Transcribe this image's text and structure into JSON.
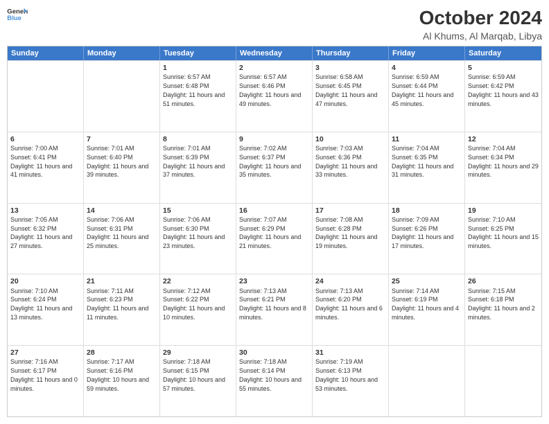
{
  "header": {
    "logo_line1": "General",
    "logo_line2": "Blue",
    "title": "October 2024",
    "subtitle": "Al Khums, Al Marqab, Libya"
  },
  "days_of_week": [
    "Sunday",
    "Monday",
    "Tuesday",
    "Wednesday",
    "Thursday",
    "Friday",
    "Saturday"
  ],
  "weeks": [
    [
      {
        "day": "",
        "sunrise": "",
        "sunset": "",
        "daylight": ""
      },
      {
        "day": "",
        "sunrise": "",
        "sunset": "",
        "daylight": ""
      },
      {
        "day": "1",
        "sunrise": "Sunrise: 6:57 AM",
        "sunset": "Sunset: 6:48 PM",
        "daylight": "Daylight: 11 hours and 51 minutes."
      },
      {
        "day": "2",
        "sunrise": "Sunrise: 6:57 AM",
        "sunset": "Sunset: 6:46 PM",
        "daylight": "Daylight: 11 hours and 49 minutes."
      },
      {
        "day": "3",
        "sunrise": "Sunrise: 6:58 AM",
        "sunset": "Sunset: 6:45 PM",
        "daylight": "Daylight: 11 hours and 47 minutes."
      },
      {
        "day": "4",
        "sunrise": "Sunrise: 6:59 AM",
        "sunset": "Sunset: 6:44 PM",
        "daylight": "Daylight: 11 hours and 45 minutes."
      },
      {
        "day": "5",
        "sunrise": "Sunrise: 6:59 AM",
        "sunset": "Sunset: 6:42 PM",
        "daylight": "Daylight: 11 hours and 43 minutes."
      }
    ],
    [
      {
        "day": "6",
        "sunrise": "Sunrise: 7:00 AM",
        "sunset": "Sunset: 6:41 PM",
        "daylight": "Daylight: 11 hours and 41 minutes."
      },
      {
        "day": "7",
        "sunrise": "Sunrise: 7:01 AM",
        "sunset": "Sunset: 6:40 PM",
        "daylight": "Daylight: 11 hours and 39 minutes."
      },
      {
        "day": "8",
        "sunrise": "Sunrise: 7:01 AM",
        "sunset": "Sunset: 6:39 PM",
        "daylight": "Daylight: 11 hours and 37 minutes."
      },
      {
        "day": "9",
        "sunrise": "Sunrise: 7:02 AM",
        "sunset": "Sunset: 6:37 PM",
        "daylight": "Daylight: 11 hours and 35 minutes."
      },
      {
        "day": "10",
        "sunrise": "Sunrise: 7:03 AM",
        "sunset": "Sunset: 6:36 PM",
        "daylight": "Daylight: 11 hours and 33 minutes."
      },
      {
        "day": "11",
        "sunrise": "Sunrise: 7:04 AM",
        "sunset": "Sunset: 6:35 PM",
        "daylight": "Daylight: 11 hours and 31 minutes."
      },
      {
        "day": "12",
        "sunrise": "Sunrise: 7:04 AM",
        "sunset": "Sunset: 6:34 PM",
        "daylight": "Daylight: 11 hours and 29 minutes."
      }
    ],
    [
      {
        "day": "13",
        "sunrise": "Sunrise: 7:05 AM",
        "sunset": "Sunset: 6:32 PM",
        "daylight": "Daylight: 11 hours and 27 minutes."
      },
      {
        "day": "14",
        "sunrise": "Sunrise: 7:06 AM",
        "sunset": "Sunset: 6:31 PM",
        "daylight": "Daylight: 11 hours and 25 minutes."
      },
      {
        "day": "15",
        "sunrise": "Sunrise: 7:06 AM",
        "sunset": "Sunset: 6:30 PM",
        "daylight": "Daylight: 11 hours and 23 minutes."
      },
      {
        "day": "16",
        "sunrise": "Sunrise: 7:07 AM",
        "sunset": "Sunset: 6:29 PM",
        "daylight": "Daylight: 11 hours and 21 minutes."
      },
      {
        "day": "17",
        "sunrise": "Sunrise: 7:08 AM",
        "sunset": "Sunset: 6:28 PM",
        "daylight": "Daylight: 11 hours and 19 minutes."
      },
      {
        "day": "18",
        "sunrise": "Sunrise: 7:09 AM",
        "sunset": "Sunset: 6:26 PM",
        "daylight": "Daylight: 11 hours and 17 minutes."
      },
      {
        "day": "19",
        "sunrise": "Sunrise: 7:10 AM",
        "sunset": "Sunset: 6:25 PM",
        "daylight": "Daylight: 11 hours and 15 minutes."
      }
    ],
    [
      {
        "day": "20",
        "sunrise": "Sunrise: 7:10 AM",
        "sunset": "Sunset: 6:24 PM",
        "daylight": "Daylight: 11 hours and 13 minutes."
      },
      {
        "day": "21",
        "sunrise": "Sunrise: 7:11 AM",
        "sunset": "Sunset: 6:23 PM",
        "daylight": "Daylight: 11 hours and 11 minutes."
      },
      {
        "day": "22",
        "sunrise": "Sunrise: 7:12 AM",
        "sunset": "Sunset: 6:22 PM",
        "daylight": "Daylight: 11 hours and 10 minutes."
      },
      {
        "day": "23",
        "sunrise": "Sunrise: 7:13 AM",
        "sunset": "Sunset: 6:21 PM",
        "daylight": "Daylight: 11 hours and 8 minutes."
      },
      {
        "day": "24",
        "sunrise": "Sunrise: 7:13 AM",
        "sunset": "Sunset: 6:20 PM",
        "daylight": "Daylight: 11 hours and 6 minutes."
      },
      {
        "day": "25",
        "sunrise": "Sunrise: 7:14 AM",
        "sunset": "Sunset: 6:19 PM",
        "daylight": "Daylight: 11 hours and 4 minutes."
      },
      {
        "day": "26",
        "sunrise": "Sunrise: 7:15 AM",
        "sunset": "Sunset: 6:18 PM",
        "daylight": "Daylight: 11 hours and 2 minutes."
      }
    ],
    [
      {
        "day": "27",
        "sunrise": "Sunrise: 7:16 AM",
        "sunset": "Sunset: 6:17 PM",
        "daylight": "Daylight: 11 hours and 0 minutes."
      },
      {
        "day": "28",
        "sunrise": "Sunrise: 7:17 AM",
        "sunset": "Sunset: 6:16 PM",
        "daylight": "Daylight: 10 hours and 59 minutes."
      },
      {
        "day": "29",
        "sunrise": "Sunrise: 7:18 AM",
        "sunset": "Sunset: 6:15 PM",
        "daylight": "Daylight: 10 hours and 57 minutes."
      },
      {
        "day": "30",
        "sunrise": "Sunrise: 7:18 AM",
        "sunset": "Sunset: 6:14 PM",
        "daylight": "Daylight: 10 hours and 55 minutes."
      },
      {
        "day": "31",
        "sunrise": "Sunrise: 7:19 AM",
        "sunset": "Sunset: 6:13 PM",
        "daylight": "Daylight: 10 hours and 53 minutes."
      },
      {
        "day": "",
        "sunrise": "",
        "sunset": "",
        "daylight": ""
      },
      {
        "day": "",
        "sunrise": "",
        "sunset": "",
        "daylight": ""
      }
    ]
  ]
}
